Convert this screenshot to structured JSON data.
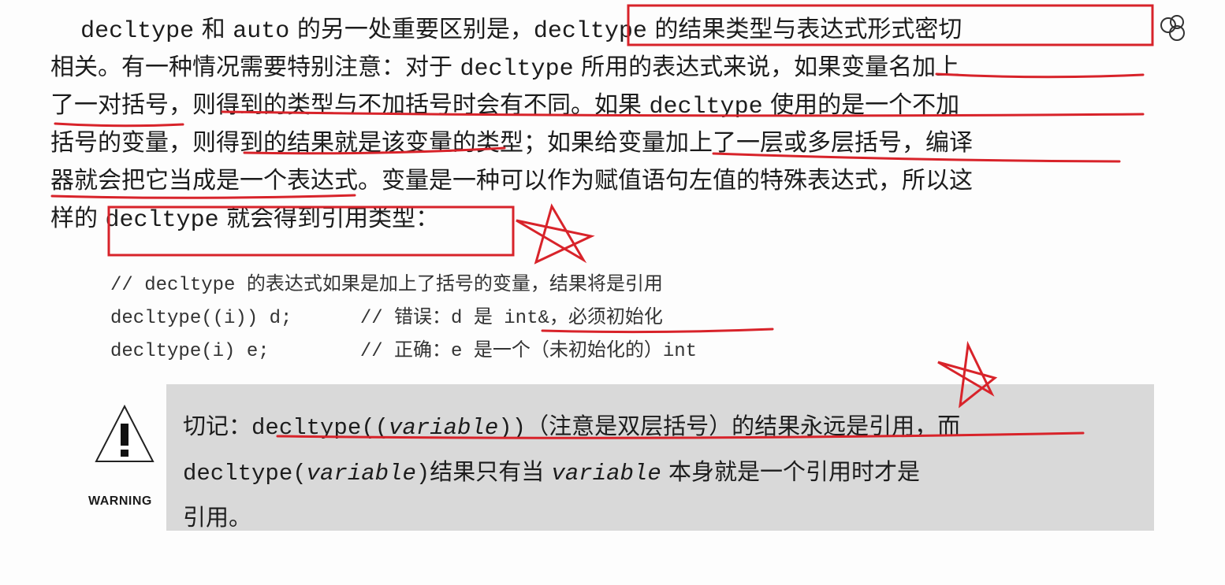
{
  "paragraph": {
    "line1": {
      "indent": "    ",
      "a": "decltype",
      "b": " 和 ",
      "c": "auto",
      "d": " 的另一处重要区别是，",
      "e": "decltype",
      "f": " 的结果类型与表达式形式密切"
    },
    "line2": {
      "a": "相关。有一种情况需要特别注意：对于 ",
      "b": "decltype",
      "c": " 所用的表达式来说，如果变量名加上"
    },
    "line3": {
      "a": "了一对括号，则得到的类型与不加括号时会有不同。如果 ",
      "b": "decltype",
      "c": " 使用的是一个不加"
    },
    "line4": {
      "a": "括号的变量，则得到的结果就是该变量的类型；如果给变量加上了一层或多层括号，编译"
    },
    "line5": {
      "a": "器就会把它当成是一个表达式。变量是一种可以作为赋值语句左值的特殊表达式，所以这"
    },
    "line6": {
      "a": "样的 ",
      "b": "decltype",
      "c": " 就会得到引用类型："
    }
  },
  "code": [
    "// decltype 的表达式如果是加上了括号的变量，结果将是引用",
    "decltype((i)) d;      // 错误：d 是 int&，必须初始化",
    "decltype(i) e;        // 正确：e 是一个（未初始化的）int"
  ],
  "warning": {
    "label": "WARNING",
    "line1": {
      "a": "切记：",
      "b": "decltype((",
      "c": "variable",
      "d": "))",
      "e": "（注意是双层括号）的结果永远是引用，而"
    },
    "line2": {
      "a": "decltype(",
      "b": "variable",
      "c": ")",
      "d": "结果只有当 ",
      "e": "variable",
      "f": " 本身就是一个引用时才是"
    },
    "line3": "引用。"
  },
  "colors": {
    "annotation": "#d8232a",
    "warning_bg": "#d9d9d9"
  }
}
